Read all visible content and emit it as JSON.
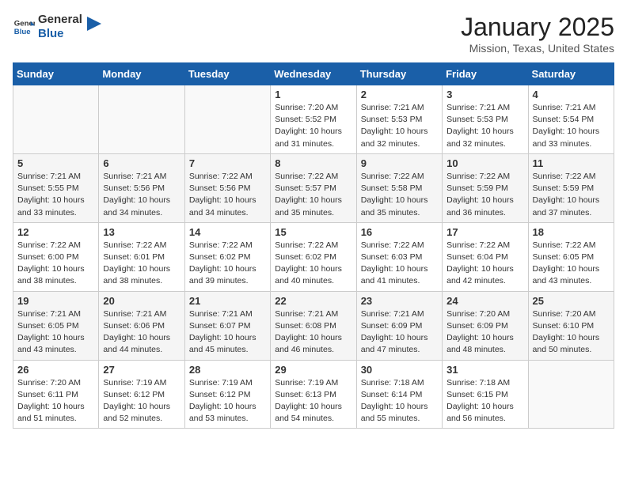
{
  "header": {
    "logo_general": "General",
    "logo_blue": "Blue",
    "title": "January 2025",
    "subtitle": "Mission, Texas, United States"
  },
  "weekdays": [
    "Sunday",
    "Monday",
    "Tuesday",
    "Wednesday",
    "Thursday",
    "Friday",
    "Saturday"
  ],
  "weeks": [
    [
      {
        "day": "",
        "info": ""
      },
      {
        "day": "",
        "info": ""
      },
      {
        "day": "",
        "info": ""
      },
      {
        "day": "1",
        "info": "Sunrise: 7:20 AM\nSunset: 5:52 PM\nDaylight: 10 hours\nand 31 minutes."
      },
      {
        "day": "2",
        "info": "Sunrise: 7:21 AM\nSunset: 5:53 PM\nDaylight: 10 hours\nand 32 minutes."
      },
      {
        "day": "3",
        "info": "Sunrise: 7:21 AM\nSunset: 5:53 PM\nDaylight: 10 hours\nand 32 minutes."
      },
      {
        "day": "4",
        "info": "Sunrise: 7:21 AM\nSunset: 5:54 PM\nDaylight: 10 hours\nand 33 minutes."
      }
    ],
    [
      {
        "day": "5",
        "info": "Sunrise: 7:21 AM\nSunset: 5:55 PM\nDaylight: 10 hours\nand 33 minutes."
      },
      {
        "day": "6",
        "info": "Sunrise: 7:21 AM\nSunset: 5:56 PM\nDaylight: 10 hours\nand 34 minutes."
      },
      {
        "day": "7",
        "info": "Sunrise: 7:22 AM\nSunset: 5:56 PM\nDaylight: 10 hours\nand 34 minutes."
      },
      {
        "day": "8",
        "info": "Sunrise: 7:22 AM\nSunset: 5:57 PM\nDaylight: 10 hours\nand 35 minutes."
      },
      {
        "day": "9",
        "info": "Sunrise: 7:22 AM\nSunset: 5:58 PM\nDaylight: 10 hours\nand 35 minutes."
      },
      {
        "day": "10",
        "info": "Sunrise: 7:22 AM\nSunset: 5:59 PM\nDaylight: 10 hours\nand 36 minutes."
      },
      {
        "day": "11",
        "info": "Sunrise: 7:22 AM\nSunset: 5:59 PM\nDaylight: 10 hours\nand 37 minutes."
      }
    ],
    [
      {
        "day": "12",
        "info": "Sunrise: 7:22 AM\nSunset: 6:00 PM\nDaylight: 10 hours\nand 38 minutes."
      },
      {
        "day": "13",
        "info": "Sunrise: 7:22 AM\nSunset: 6:01 PM\nDaylight: 10 hours\nand 38 minutes."
      },
      {
        "day": "14",
        "info": "Sunrise: 7:22 AM\nSunset: 6:02 PM\nDaylight: 10 hours\nand 39 minutes."
      },
      {
        "day": "15",
        "info": "Sunrise: 7:22 AM\nSunset: 6:02 PM\nDaylight: 10 hours\nand 40 minutes."
      },
      {
        "day": "16",
        "info": "Sunrise: 7:22 AM\nSunset: 6:03 PM\nDaylight: 10 hours\nand 41 minutes."
      },
      {
        "day": "17",
        "info": "Sunrise: 7:22 AM\nSunset: 6:04 PM\nDaylight: 10 hours\nand 42 minutes."
      },
      {
        "day": "18",
        "info": "Sunrise: 7:22 AM\nSunset: 6:05 PM\nDaylight: 10 hours\nand 43 minutes."
      }
    ],
    [
      {
        "day": "19",
        "info": "Sunrise: 7:21 AM\nSunset: 6:05 PM\nDaylight: 10 hours\nand 43 minutes."
      },
      {
        "day": "20",
        "info": "Sunrise: 7:21 AM\nSunset: 6:06 PM\nDaylight: 10 hours\nand 44 minutes."
      },
      {
        "day": "21",
        "info": "Sunrise: 7:21 AM\nSunset: 6:07 PM\nDaylight: 10 hours\nand 45 minutes."
      },
      {
        "day": "22",
        "info": "Sunrise: 7:21 AM\nSunset: 6:08 PM\nDaylight: 10 hours\nand 46 minutes."
      },
      {
        "day": "23",
        "info": "Sunrise: 7:21 AM\nSunset: 6:09 PM\nDaylight: 10 hours\nand 47 minutes."
      },
      {
        "day": "24",
        "info": "Sunrise: 7:20 AM\nSunset: 6:09 PM\nDaylight: 10 hours\nand 48 minutes."
      },
      {
        "day": "25",
        "info": "Sunrise: 7:20 AM\nSunset: 6:10 PM\nDaylight: 10 hours\nand 50 minutes."
      }
    ],
    [
      {
        "day": "26",
        "info": "Sunrise: 7:20 AM\nSunset: 6:11 PM\nDaylight: 10 hours\nand 51 minutes."
      },
      {
        "day": "27",
        "info": "Sunrise: 7:19 AM\nSunset: 6:12 PM\nDaylight: 10 hours\nand 52 minutes."
      },
      {
        "day": "28",
        "info": "Sunrise: 7:19 AM\nSunset: 6:12 PM\nDaylight: 10 hours\nand 53 minutes."
      },
      {
        "day": "29",
        "info": "Sunrise: 7:19 AM\nSunset: 6:13 PM\nDaylight: 10 hours\nand 54 minutes."
      },
      {
        "day": "30",
        "info": "Sunrise: 7:18 AM\nSunset: 6:14 PM\nDaylight: 10 hours\nand 55 minutes."
      },
      {
        "day": "31",
        "info": "Sunrise: 7:18 AM\nSunset: 6:15 PM\nDaylight: 10 hours\nand 56 minutes."
      },
      {
        "day": "",
        "info": ""
      }
    ]
  ]
}
